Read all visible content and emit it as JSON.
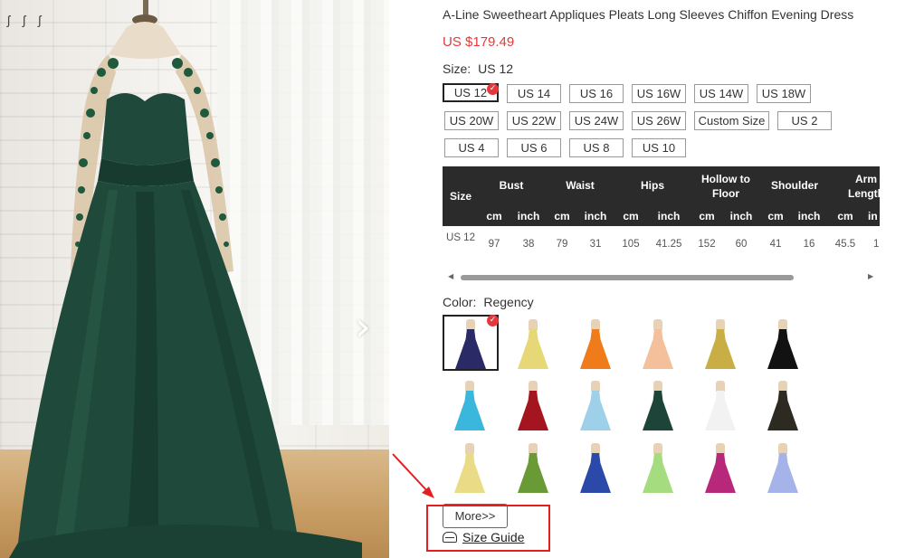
{
  "product": {
    "title": "A-Line Sweetheart Appliques Pleats Long Sleeves Chiffon Evening Dress",
    "price": "US $179.49"
  },
  "size": {
    "label": "Size:",
    "selected_value": "US 12",
    "options": [
      "US 12",
      "US 14",
      "US 16",
      "US 16W",
      "US 14W",
      "US 18W",
      "US 20W",
      "US 22W",
      "US 24W",
      "US 26W",
      "Custom Size",
      "US 2",
      "US 4",
      "US 6",
      "US 8",
      "US 10"
    ]
  },
  "size_table": {
    "size_header": "Size",
    "columns": [
      "Bust",
      "Waist",
      "Hips",
      "Hollow to Floor",
      "Shoulder",
      "Arm Length"
    ],
    "units": [
      "cm",
      "inch",
      "cm",
      "inch",
      "cm",
      "inch",
      "cm",
      "inch",
      "cm",
      "inch",
      "cm",
      "in"
    ],
    "row": {
      "size": "US 12",
      "values": [
        "97",
        "38",
        "79",
        "31",
        "105",
        "41.25",
        "152",
        "60",
        "41",
        "16",
        "45.5",
        "1"
      ]
    }
  },
  "color": {
    "label": "Color:",
    "selected_value": "Regency",
    "swatches": [
      {
        "color": "#2a2a66"
      },
      {
        "color": "#e6d777"
      },
      {
        "color": "#f07b1b"
      },
      {
        "color": "#f4bf9b"
      },
      {
        "color": "#c8ae45"
      },
      {
        "color": "#121212"
      },
      {
        "color": "#3bb7dd"
      },
      {
        "color": "#a5151f"
      },
      {
        "color": "#9ed0ea"
      },
      {
        "color": "#1d4438"
      },
      {
        "color": "#f2f2f2"
      },
      {
        "color": "#2d2a22"
      },
      {
        "color": "#eadc86"
      },
      {
        "color": "#6a9a36"
      },
      {
        "color": "#2b49a8"
      },
      {
        "color": "#a6dc80"
      },
      {
        "color": "#b7277a"
      },
      {
        "color": "#a6b3e8"
      }
    ]
  },
  "actions": {
    "more_label": "More>>",
    "size_guide_label": "Size Guide"
  },
  "accent": {
    "price_red": "#e4393c",
    "annotation_red": "#e4201f",
    "dress_green": "#1f4a3b"
  }
}
